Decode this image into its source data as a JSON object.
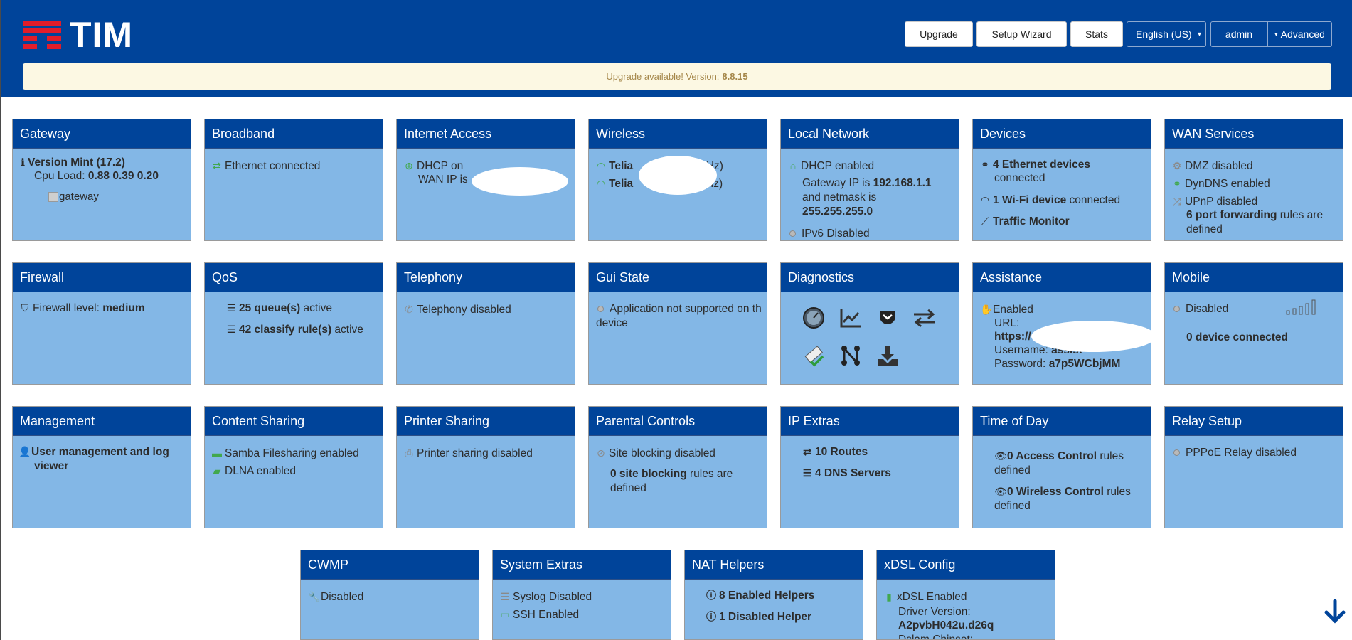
{
  "header": {
    "logo_text": "TIM",
    "buttons": {
      "upgrade": "Upgrade",
      "setup_wizard": "Setup Wizard",
      "stats": "Stats",
      "language": "English (US)",
      "user": "admin",
      "advanced": "Advanced"
    },
    "upgrade_notice": "Upgrade available! Version:",
    "upgrade_version": "8.8.15"
  },
  "colors": {
    "header_bg": "#00449a",
    "card_bg": "#83b7e6",
    "accent_green": "#41a84d",
    "notice_bg": "#fcf8e3"
  },
  "cards": {
    "gateway": {
      "title": "Gateway",
      "version": "Version Mint (17.2)",
      "cpu_label": "Cpu Load:",
      "cpu_value": "0.88 0.39 0.20",
      "image_alt": "gateway"
    },
    "broadband": {
      "title": "Broadband",
      "status": "Ethernet connected"
    },
    "internet": {
      "title": "Internet Access",
      "line1": "DHCP on",
      "line2": "WAN IP is"
    },
    "wireless": {
      "title": "Wireless",
      "ssid1": "Telia",
      "ssid1_suffix": "4GHz)",
      "ssid2": "Telia",
      "ssid2_suffix": "(5GHz)"
    },
    "local": {
      "title": "Local Network",
      "dhcp": "DHCP enabled",
      "gw_label": "Gateway IP is",
      "gw_ip": "192.168.1.1",
      "netmask_label": "and netmask is",
      "netmask": "255.255.255.0",
      "ipv6": "IPv6 Disabled"
    },
    "devices": {
      "title": "Devices",
      "eth_count": "4 Ethernet devices",
      "eth_suffix": "connected",
      "wifi_count": "1 Wi-Fi device",
      "wifi_suffix": "connected",
      "traffic": "Traffic Monitor"
    },
    "wan": {
      "title": "WAN Services",
      "dmz": "DMZ disabled",
      "dyndns": "DynDNS enabled",
      "upnp": "UPnP disabled",
      "pf_count": "6 port forwarding",
      "pf_suffix": "rules are defined"
    },
    "firewall": {
      "title": "Firewall",
      "label": "Firewall level:",
      "level": "medium"
    },
    "qos": {
      "title": "QoS",
      "queues": "25 queue(s)",
      "queues_suffix": "active",
      "rules": "42 classify rule(s)",
      "rules_suffix": "active"
    },
    "telephony": {
      "title": "Telephony",
      "status": "Telephony disabled"
    },
    "gui": {
      "title": "Gui State",
      "status": "Application not supported on th",
      "status2": "device"
    },
    "diagnostics": {
      "title": "Diagnostics",
      "icons": [
        "speedometer-icon",
        "chart-icon",
        "pocket-icon",
        "exchange-icon",
        "eraser-check-icon",
        "network-icon",
        "download-icon"
      ]
    },
    "assistance": {
      "title": "Assistance",
      "status": "Enabled",
      "url_label": "URL:",
      "url_value": "https://",
      "user_label": "Username:",
      "user_value": "assist",
      "pass_label": "Password:",
      "pass_value": "a7p5WCbjMM"
    },
    "mobile": {
      "title": "Mobile",
      "status": "Disabled",
      "devices": "0 device connected"
    },
    "management": {
      "title": "Management",
      "text": "User management and log viewer"
    },
    "content": {
      "title": "Content Sharing",
      "samba": "Samba Filesharing enabled",
      "dlna": "DLNA enabled"
    },
    "printer": {
      "title": "Printer Sharing",
      "status": "Printer sharing disabled"
    },
    "parental": {
      "title": "Parental Controls",
      "status": "Site blocking disabled",
      "count": "0 site blocking",
      "count_suffix": "rules are defined"
    },
    "ipextras": {
      "title": "IP Extras",
      "routes": "10 Routes",
      "dns": "4 DNS Servers"
    },
    "timeofday": {
      "title": "Time of Day",
      "access": "0 Access Control",
      "access_suffix": "rules defined",
      "wireless": "0 Wireless Control",
      "wireless_suffix": "rules defined"
    },
    "relay": {
      "title": "Relay Setup",
      "status": "PPPoE Relay disabled"
    },
    "cwmp": {
      "title": "CWMP",
      "status": "Disabled"
    },
    "system": {
      "title": "System Extras",
      "syslog": "Syslog Disabled",
      "ssh": "SSH Enabled"
    },
    "nat": {
      "title": "NAT Helpers",
      "enabled": "8 Enabled Helpers",
      "disabled": "1 Disabled Helper"
    },
    "xdsl": {
      "title": "xDSL Config",
      "status": "xDSL Enabled",
      "driver_label": "Driver Version:",
      "driver": "A2pvbH042u.d26q",
      "cut": "Dslam Chipset:"
    }
  }
}
